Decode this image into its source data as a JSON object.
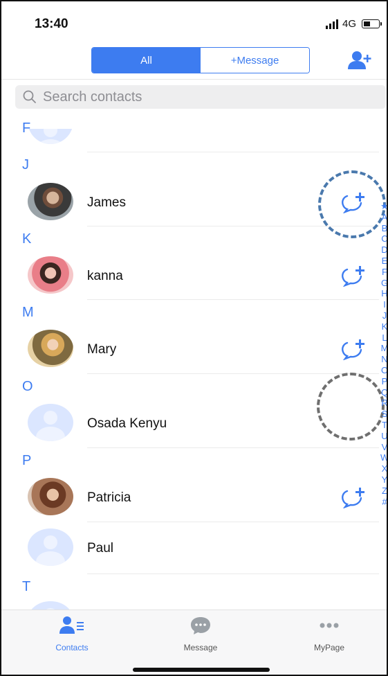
{
  "status_bar": {
    "time": "13:40",
    "network": "4G"
  },
  "header": {
    "segments": [
      {
        "label": "All",
        "active": true
      },
      {
        "label": "+Message",
        "active": false
      }
    ],
    "add_contact_icon": "person-plus-icon"
  },
  "search": {
    "placeholder": "Search contacts"
  },
  "contacts": {
    "sections": [
      "F",
      "J",
      "K",
      "M",
      "O",
      "P",
      "T"
    ],
    "rows": [
      {
        "name": "James",
        "avatar": "photo",
        "has_chat_add": true
      },
      {
        "name": "kanna",
        "avatar": "photo",
        "has_chat_add": true
      },
      {
        "name": "Mary",
        "avatar": "photo",
        "has_chat_add": true
      },
      {
        "name": "Osada Kenyu",
        "avatar": "default",
        "has_chat_add": false
      },
      {
        "name": "Patricia",
        "avatar": "photo",
        "has_chat_add": true
      },
      {
        "name": "Paul",
        "avatar": "default",
        "has_chat_add": false
      }
    ]
  },
  "index_bar": [
    "★",
    "A",
    "B",
    "C",
    "D",
    "E",
    "F",
    "G",
    "H",
    "I",
    "J",
    "K",
    "L",
    "M",
    "N",
    "O",
    "P",
    "Q",
    "R",
    "S",
    "T",
    "U",
    "V",
    "W",
    "X",
    "Y",
    "Z",
    "#"
  ],
  "tabbar": {
    "items": [
      {
        "label": "Contacts",
        "icon": "contacts-icon",
        "active": true
      },
      {
        "label": "Message",
        "icon": "chat-bubble-icon",
        "active": false
      },
      {
        "label": "MyPage",
        "icon": "more-dots-icon",
        "active": false
      }
    ]
  },
  "colors": {
    "accent": "#3d7cf0",
    "highlight_ring": "#4a79ad",
    "muted_ring": "#6f6f6f"
  }
}
